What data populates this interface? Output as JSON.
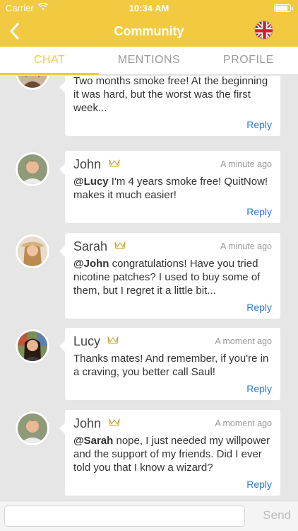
{
  "status_bar": {
    "carrier": "Carrier",
    "time": "10:34 AM"
  },
  "header": {
    "title": "Community",
    "flag": "uk-flag-icon"
  },
  "tabs": [
    {
      "label": "CHAT",
      "active": true
    },
    {
      "label": "MENTIONS",
      "active": false
    },
    {
      "label": "PROFILE",
      "active": false
    }
  ],
  "messages": [
    {
      "author": "",
      "time": "",
      "mention": "",
      "text": "Two months smoke free! At the beginning it was hard, but the worst was the first week...",
      "reply": "Reply"
    },
    {
      "author": "John",
      "time": "A minute ago",
      "mention": "@Lucy",
      "text": " I'm 4 years smoke free! QuitNow! makes it much easier!",
      "reply": "Reply"
    },
    {
      "author": "Sarah",
      "time": "A minute ago",
      "mention": "@John",
      "text": " congratulations! Have you tried nicotine patches? I used to buy some of them, but I regret it a little bit...",
      "reply": "Reply"
    },
    {
      "author": "Lucy",
      "time": "A moment ago",
      "mention": "",
      "text": "Thanks mates! And remember, if you're in a craving, you better call Saul!",
      "reply": "Reply"
    },
    {
      "author": "John",
      "time": "A moment ago",
      "mention": "@Sarah",
      "text": " nope, I just needed my willpower and the support of my friends. Did I ever told you that I know a wizard?",
      "reply": "Reply"
    }
  ],
  "composer": {
    "placeholder": "",
    "send_label": "Send"
  },
  "colors": {
    "accent": "#f2ca42",
    "link": "#2d7ad3",
    "background": "#e6e6e6"
  }
}
